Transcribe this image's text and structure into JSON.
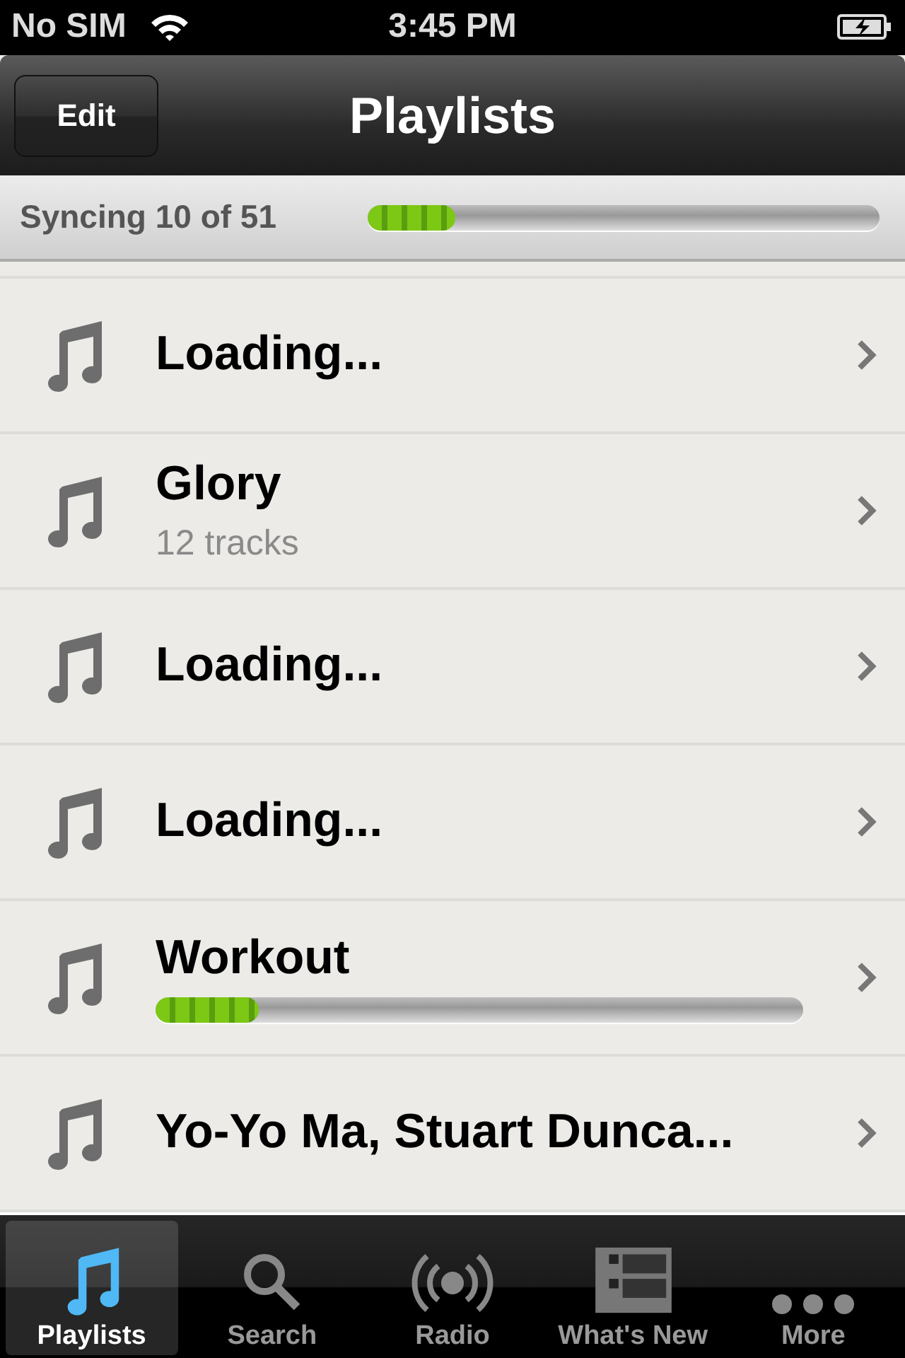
{
  "status_bar": {
    "carrier": "No SIM",
    "time": "3:45 PM"
  },
  "nav_bar": {
    "title": "Playlists",
    "edit_button": "Edit"
  },
  "sync": {
    "text": "Syncing 10 of 51",
    "level": 0.17
  },
  "playlists": [
    {
      "kind": "plain",
      "title": "Loading..."
    },
    {
      "kind": "subtitle",
      "title": "Glory",
      "subtitle": "12 tracks"
    },
    {
      "kind": "plain",
      "title": "Loading..."
    },
    {
      "kind": "plain",
      "title": "Loading..."
    },
    {
      "kind": "progress",
      "title": "Workout",
      "level": 0.16
    },
    {
      "kind": "plain",
      "title": "Yo-Yo Ma, Stuart Dunca..."
    }
  ],
  "tabs": [
    {
      "label": "Playlists",
      "kind": "note",
      "selected": true
    },
    {
      "label": "Search",
      "kind": "search",
      "selected": false
    },
    {
      "label": "Radio",
      "kind": "radio",
      "selected": false
    },
    {
      "label": "What's New",
      "kind": "news",
      "selected": false
    },
    {
      "label": "More",
      "kind": "more",
      "selected": false
    }
  ]
}
